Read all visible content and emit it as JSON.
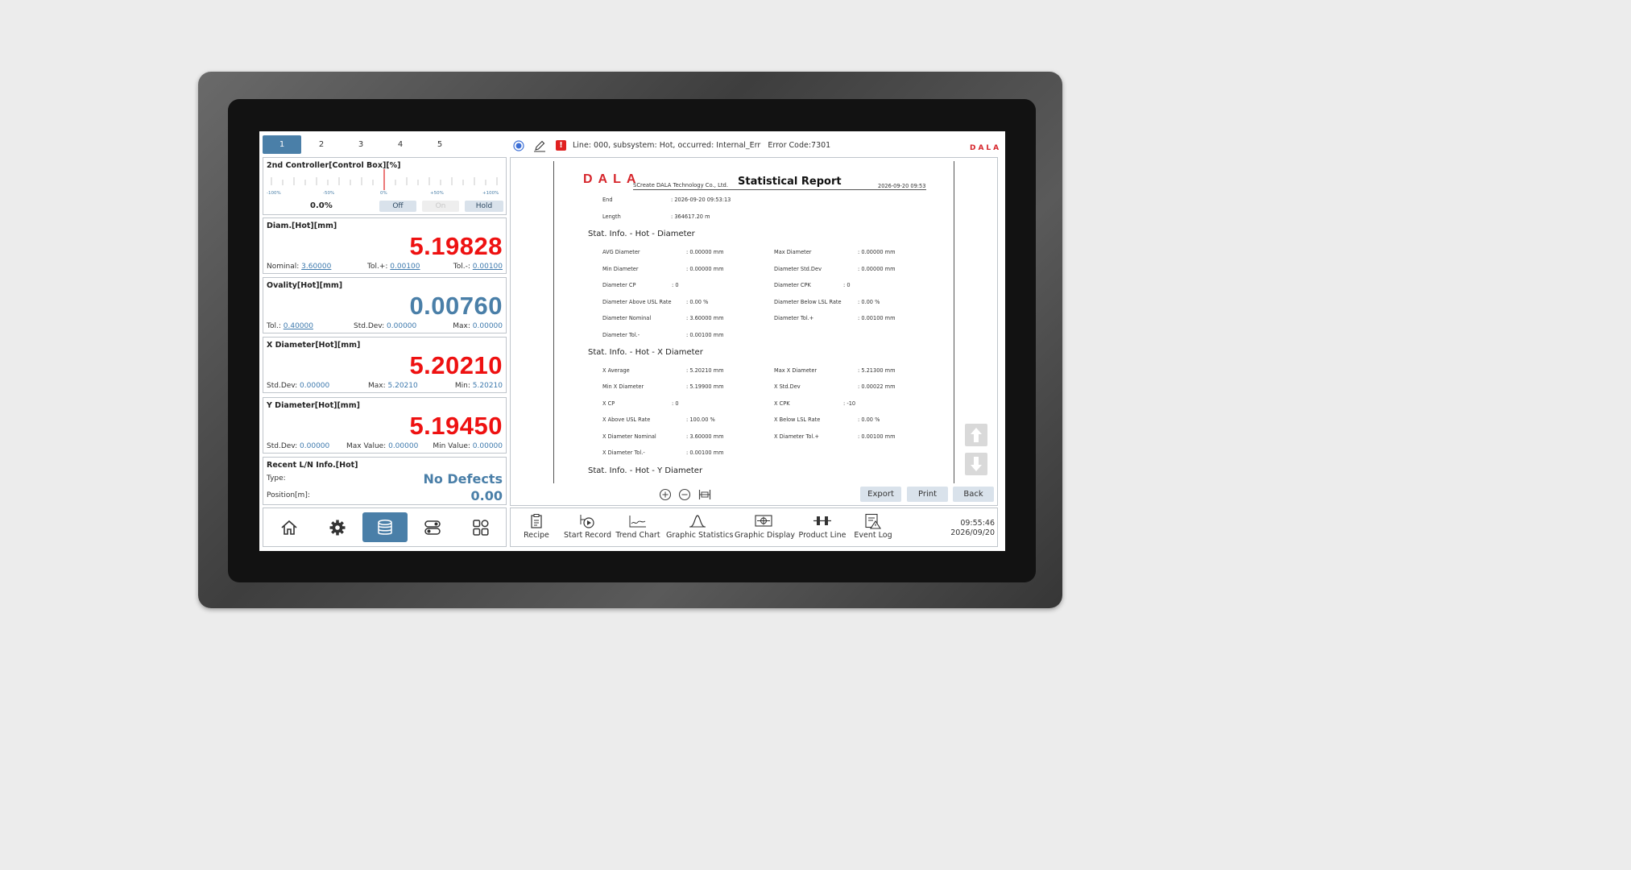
{
  "tabs": [
    "1",
    "2",
    "3",
    "4",
    "5"
  ],
  "controller": {
    "title": "2nd Controller[Control Box][%]",
    "ticks": [
      "-100%",
      "-50%",
      "0%",
      "+50%",
      "+100%"
    ],
    "value": "0.0%",
    "buttons": [
      "Off",
      "On",
      "Hold"
    ]
  },
  "diam": {
    "title": "Diam.[Hot][mm]",
    "value": "5.19828",
    "nominal_label": "Nominal:",
    "nominal": "3.60000",
    "tolp_label": "Tol.+:",
    "tolp": "0.00100",
    "tolm_label": "Tol.-:",
    "tolm": "0.00100"
  },
  "ovality": {
    "title": "Ovality[Hot][mm]",
    "value": "0.00760",
    "tol_label": "Tol.:",
    "tol": "0.40000",
    "std_label": "Std.Dev:",
    "std": "0.00000",
    "max_label": "Max:",
    "max": "0.00000"
  },
  "xdiam": {
    "title": "X Diameter[Hot][mm]",
    "value": "5.20210",
    "std_label": "Std.Dev:",
    "std": "0.00000",
    "max_label": "Max:",
    "max": "5.20210",
    "min_label": "Min:",
    "min": "5.20210"
  },
  "ydiam": {
    "title": "Y Diameter[Hot][mm]",
    "value": "5.19450",
    "std_label": "Std.Dev:",
    "std": "0.00000",
    "max_label": "Max Value:",
    "max": "0.00000",
    "min_label": "Min Value:",
    "min": "0.00000"
  },
  "ln": {
    "title": "Recent L/N Info.[Hot]",
    "type_label": "Type:",
    "type": "No Defects",
    "pos_label": "Position[m]:",
    "pos": "0.00"
  },
  "nav": [
    "home-icon",
    "gear-icon",
    "database-icon",
    "toggle-icon",
    "apps-icon"
  ],
  "header": {
    "message": "Line: 000, subsystem: Hot, occurred: Internal_Err   Error Code:7301",
    "brand": "DALA",
    "brand_color": "#d6252b",
    "accent": "#4a7fa8"
  },
  "report": {
    "logo": "DALA",
    "company": "SCreate DALA Technology Co., Ltd.",
    "title": "Statistical Report",
    "date": "2026-09-20 09:53",
    "top": [
      {
        "label": "End",
        "value": ": 2026-09-20 09:53:13"
      },
      {
        "label": "Length",
        "value": ": 364617.20 m"
      }
    ],
    "sections": [
      {
        "title": "Stat. Info. - Hot - Diameter",
        "rows": [
          {
            "l1": "AVG Diameter",
            "v1": ": 0.00000 mm",
            "l2": "Max Diameter",
            "v2": ": 0.00000 mm"
          },
          {
            "l1": "Min Diameter",
            "v1": ": 0.00000 mm",
            "l2": "Diameter Std.Dev",
            "v2": ": 0.00000 mm"
          },
          {
            "l1": "Diameter CP",
            "v1": ": 0",
            "l2": "Diameter CPK",
            "v2": ": 0"
          },
          {
            "l1": "Diameter Above USL Rate",
            "v1": ": 0.00 %",
            "l2": "Diameter Below LSL Rate",
            "v2": ": 0.00 %"
          },
          {
            "l1": "Diameter Nominal",
            "v1": ": 3.60000 mm",
            "l2": "Diameter Tol.+",
            "v2": ": 0.00100 mm"
          },
          {
            "l1": "Diameter Tol.-",
            "v1": ": 0.00100 mm",
            "l2": "",
            "v2": ""
          }
        ]
      },
      {
        "title": "Stat. Info. - Hot - X Diameter",
        "rows": [
          {
            "l1": "X Average",
            "v1": ": 5.20210 mm",
            "l2": "Max X Diameter",
            "v2": ": 5.21300 mm"
          },
          {
            "l1": "Min X Diameter",
            "v1": ": 5.19900 mm",
            "l2": "X Std.Dev",
            "v2": ": 0.00022 mm"
          },
          {
            "l1": "X CP",
            "v1": ": 0",
            "l2": "X CPK",
            "v2": ": -10"
          },
          {
            "l1": "X Above USL Rate",
            "v1": ": 100.00 %",
            "l2": "X Below LSL Rate",
            "v2": ": 0.00 %"
          },
          {
            "l1": "X Diameter Nominal",
            "v1": ": 3.60000 mm",
            "l2": "X Diameter Tol.+",
            "v2": ": 0.00100 mm"
          },
          {
            "l1": "X Diameter Tol.-",
            "v1": ": 0.00100 mm",
            "l2": "",
            "v2": ""
          }
        ]
      },
      {
        "title": "Stat. Info. - Hot - Y Diameter",
        "rows": []
      }
    ]
  },
  "report_buttons": {
    "export": "Export",
    "print": "Print",
    "back": "Back"
  },
  "toolbar": [
    "Recipe",
    "Start Record",
    "Trend Chart",
    "Graphic Statistics",
    "Graphic Display",
    "Product Line",
    "Event Log"
  ],
  "clock": {
    "time": "09:55:46",
    "date": "2026/09/20"
  }
}
